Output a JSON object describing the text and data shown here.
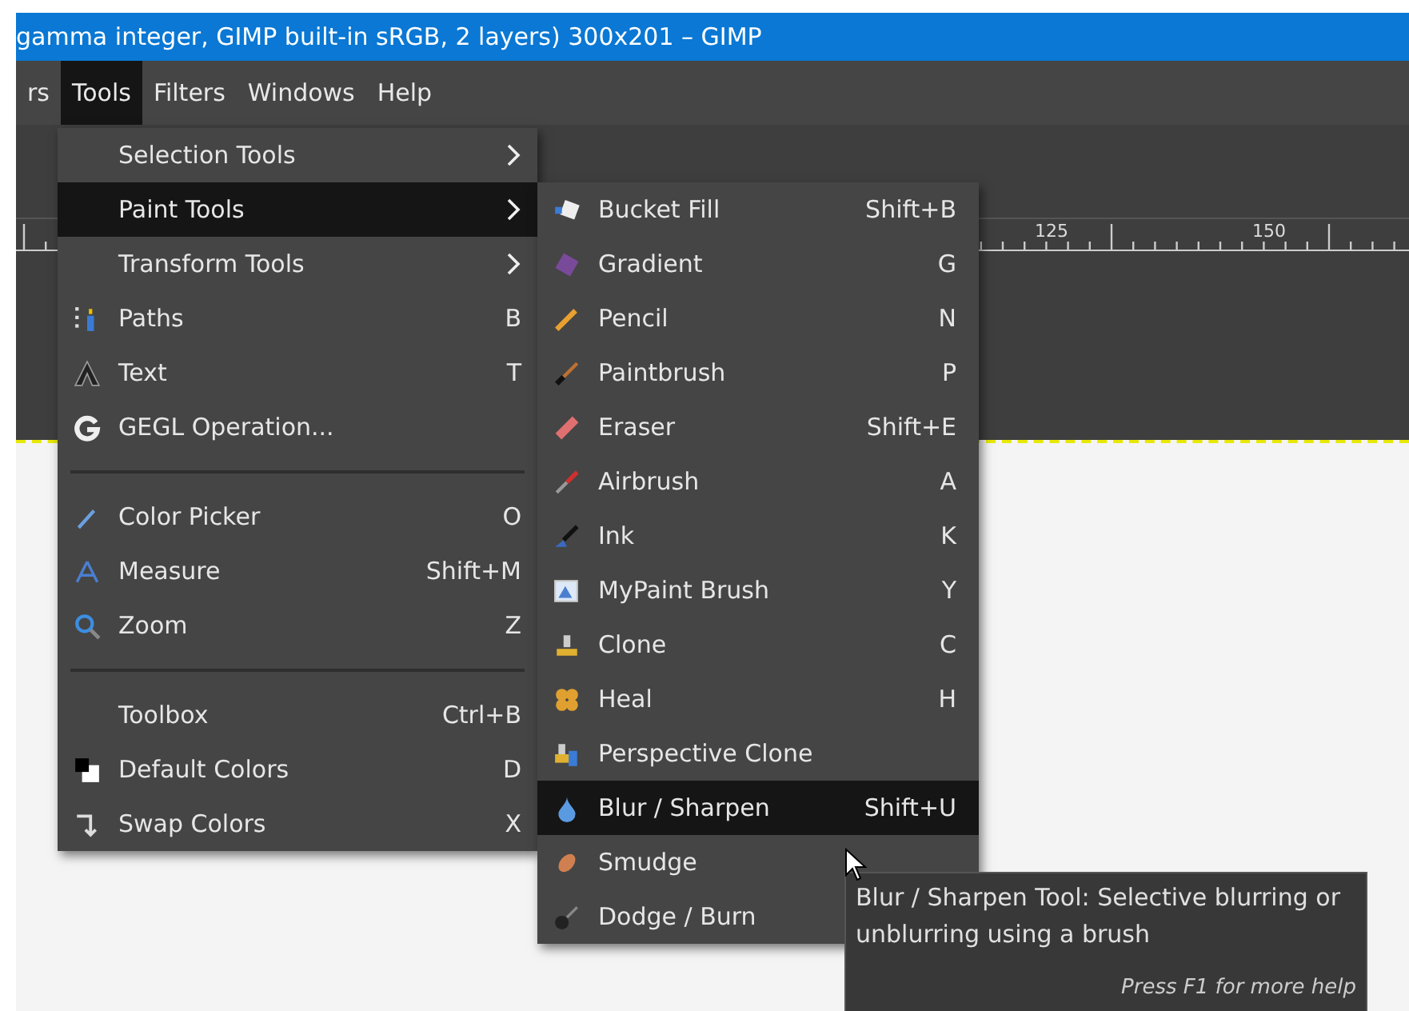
{
  "window": {
    "title": "gamma integer, GIMP built-in sRGB, 2 layers) 300x201 – GIMP"
  },
  "menubar": [
    {
      "label": "rs",
      "selected": false
    },
    {
      "label": "Tools",
      "selected": true
    },
    {
      "label": "Filters",
      "selected": false
    },
    {
      "label": "Windows",
      "selected": false
    },
    {
      "label": "Help",
      "selected": false
    }
  ],
  "ruler": {
    "labels": [
      "125",
      "150"
    ]
  },
  "tools_menu": [
    {
      "kind": "submenu",
      "label": "Selection Tools",
      "selected": false
    },
    {
      "kind": "submenu",
      "label": "Paint Tools",
      "selected": true
    },
    {
      "kind": "submenu",
      "label": "Transform Tools",
      "selected": false
    },
    {
      "kind": "item",
      "label": "Paths",
      "shortcut": "B",
      "selected": false
    },
    {
      "kind": "item",
      "label": "Text",
      "shortcut": "T",
      "selected": false
    },
    {
      "kind": "item",
      "label": "GEGL Operation...",
      "selected": false
    },
    {
      "kind": "separator"
    },
    {
      "kind": "item",
      "label": "Color Picker",
      "shortcut": "O",
      "selected": false
    },
    {
      "kind": "item",
      "label": "Measure",
      "shortcut": "Shift+M",
      "selected": false
    },
    {
      "kind": "item",
      "label": "Zoom",
      "shortcut": "Z",
      "selected": false
    },
    {
      "kind": "separator"
    },
    {
      "kind": "item",
      "label": "Toolbox",
      "shortcut": "Ctrl+B",
      "selected": false
    },
    {
      "kind": "item",
      "label": "Default Colors",
      "shortcut": "D",
      "selected": false
    },
    {
      "kind": "item",
      "label": "Swap Colors",
      "shortcut": "X",
      "selected": false
    }
  ],
  "paint_tools_menu": [
    {
      "label": "Bucket Fill",
      "shortcut": "Shift+B",
      "selected": false
    },
    {
      "label": "Gradient",
      "shortcut": "G",
      "selected": false
    },
    {
      "label": "Pencil",
      "shortcut": "N",
      "selected": false
    },
    {
      "label": "Paintbrush",
      "shortcut": "P",
      "selected": false
    },
    {
      "label": "Eraser",
      "shortcut": "Shift+E",
      "selected": false
    },
    {
      "label": "Airbrush",
      "shortcut": "A",
      "selected": false
    },
    {
      "label": "Ink",
      "shortcut": "K",
      "selected": false
    },
    {
      "label": "MyPaint Brush",
      "shortcut": "Y",
      "selected": false
    },
    {
      "label": "Clone",
      "shortcut": "C",
      "selected": false
    },
    {
      "label": "Heal",
      "shortcut": "H",
      "selected": false
    },
    {
      "label": "Perspective Clone",
      "selected": false
    },
    {
      "label": "Blur / Sharpen",
      "shortcut": "Shift+U",
      "selected": true
    },
    {
      "label": "Smudge",
      "selected": false
    },
    {
      "label": "Dodge / Burn",
      "selected": false
    }
  ],
  "tooltip": {
    "text": "Blur / Sharpen Tool: Selective blurring or unblurring using a brush",
    "hint": "Press F1 for more help"
  }
}
